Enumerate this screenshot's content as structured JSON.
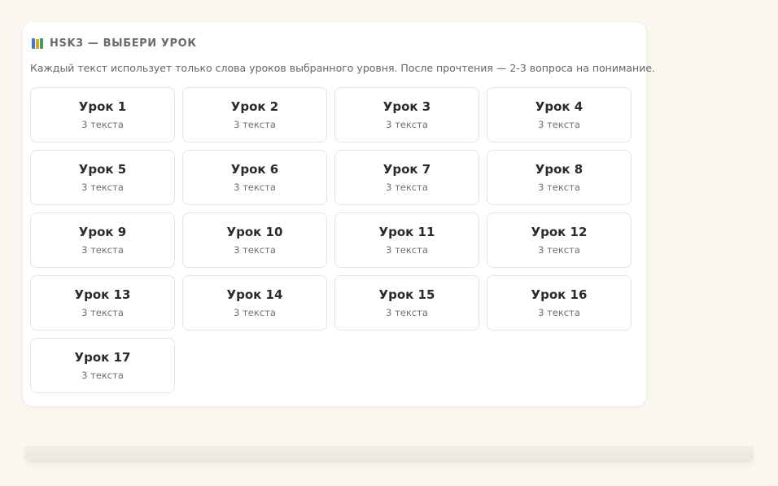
{
  "panel": {
    "title": "HSK3 — ВЫБЕРИ УРОК",
    "icon": "books-icon",
    "description": "Каждый текст использует только слова уроков выбранного уровня. После прочтения — 2-3 вопроса на понимание."
  },
  "lessons": [
    {
      "name": "Урок 1",
      "count": "3 текста"
    },
    {
      "name": "Урок 2",
      "count": "3 текста"
    },
    {
      "name": "Урок 3",
      "count": "3 текста"
    },
    {
      "name": "Урок 4",
      "count": "3 текста"
    },
    {
      "name": "Урок 5",
      "count": "3 текста"
    },
    {
      "name": "Урок 6",
      "count": "3 текста"
    },
    {
      "name": "Урок 7",
      "count": "3 текста"
    },
    {
      "name": "Урок 8",
      "count": "3 текста"
    },
    {
      "name": "Урок 9",
      "count": "3 текста"
    },
    {
      "name": "Урок 10",
      "count": "3 текста"
    },
    {
      "name": "Урок 11",
      "count": "3 текста"
    },
    {
      "name": "Урок 12",
      "count": "3 текста"
    },
    {
      "name": "Урок 13",
      "count": "3 текста"
    },
    {
      "name": "Урок 14",
      "count": "3 текста"
    },
    {
      "name": "Урок 15",
      "count": "3 текста"
    },
    {
      "name": "Урок 16",
      "count": "3 текста"
    },
    {
      "name": "Урок 17",
      "count": "3 текста"
    }
  ],
  "colors": {
    "background": "#faf7f0",
    "panel": "#ffffff",
    "card_border": "#e6e4df",
    "title_text": "#6b6b6b",
    "lesson_text": "#2b2b2b"
  }
}
